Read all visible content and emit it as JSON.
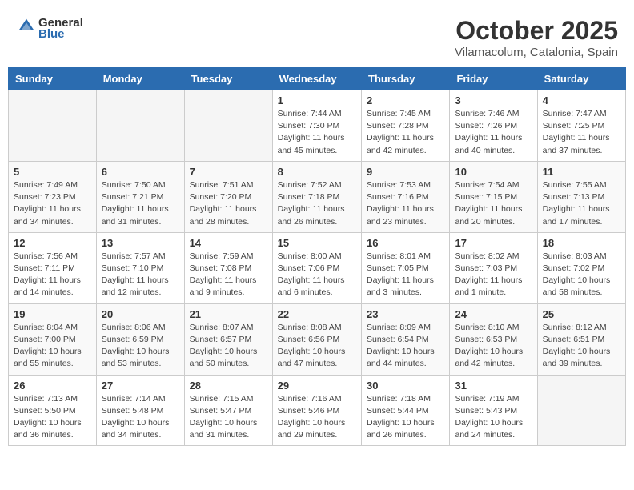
{
  "header": {
    "logo_line1": "General",
    "logo_line2": "Blue",
    "month": "October 2025",
    "location": "Vilamacolum, Catalonia, Spain"
  },
  "weekdays": [
    "Sunday",
    "Monday",
    "Tuesday",
    "Wednesday",
    "Thursday",
    "Friday",
    "Saturday"
  ],
  "weeks": [
    [
      {
        "day": "",
        "info": ""
      },
      {
        "day": "",
        "info": ""
      },
      {
        "day": "",
        "info": ""
      },
      {
        "day": "1",
        "info": "Sunrise: 7:44 AM\nSunset: 7:30 PM\nDaylight: 11 hours\nand 45 minutes."
      },
      {
        "day": "2",
        "info": "Sunrise: 7:45 AM\nSunset: 7:28 PM\nDaylight: 11 hours\nand 42 minutes."
      },
      {
        "day": "3",
        "info": "Sunrise: 7:46 AM\nSunset: 7:26 PM\nDaylight: 11 hours\nand 40 minutes."
      },
      {
        "day": "4",
        "info": "Sunrise: 7:47 AM\nSunset: 7:25 PM\nDaylight: 11 hours\nand 37 minutes."
      }
    ],
    [
      {
        "day": "5",
        "info": "Sunrise: 7:49 AM\nSunset: 7:23 PM\nDaylight: 11 hours\nand 34 minutes."
      },
      {
        "day": "6",
        "info": "Sunrise: 7:50 AM\nSunset: 7:21 PM\nDaylight: 11 hours\nand 31 minutes."
      },
      {
        "day": "7",
        "info": "Sunrise: 7:51 AM\nSunset: 7:20 PM\nDaylight: 11 hours\nand 28 minutes."
      },
      {
        "day": "8",
        "info": "Sunrise: 7:52 AM\nSunset: 7:18 PM\nDaylight: 11 hours\nand 26 minutes."
      },
      {
        "day": "9",
        "info": "Sunrise: 7:53 AM\nSunset: 7:16 PM\nDaylight: 11 hours\nand 23 minutes."
      },
      {
        "day": "10",
        "info": "Sunrise: 7:54 AM\nSunset: 7:15 PM\nDaylight: 11 hours\nand 20 minutes."
      },
      {
        "day": "11",
        "info": "Sunrise: 7:55 AM\nSunset: 7:13 PM\nDaylight: 11 hours\nand 17 minutes."
      }
    ],
    [
      {
        "day": "12",
        "info": "Sunrise: 7:56 AM\nSunset: 7:11 PM\nDaylight: 11 hours\nand 14 minutes."
      },
      {
        "day": "13",
        "info": "Sunrise: 7:57 AM\nSunset: 7:10 PM\nDaylight: 11 hours\nand 12 minutes."
      },
      {
        "day": "14",
        "info": "Sunrise: 7:59 AM\nSunset: 7:08 PM\nDaylight: 11 hours\nand 9 minutes."
      },
      {
        "day": "15",
        "info": "Sunrise: 8:00 AM\nSunset: 7:06 PM\nDaylight: 11 hours\nand 6 minutes."
      },
      {
        "day": "16",
        "info": "Sunrise: 8:01 AM\nSunset: 7:05 PM\nDaylight: 11 hours\nand 3 minutes."
      },
      {
        "day": "17",
        "info": "Sunrise: 8:02 AM\nSunset: 7:03 PM\nDaylight: 11 hours\nand 1 minute."
      },
      {
        "day": "18",
        "info": "Sunrise: 8:03 AM\nSunset: 7:02 PM\nDaylight: 10 hours\nand 58 minutes."
      }
    ],
    [
      {
        "day": "19",
        "info": "Sunrise: 8:04 AM\nSunset: 7:00 PM\nDaylight: 10 hours\nand 55 minutes."
      },
      {
        "day": "20",
        "info": "Sunrise: 8:06 AM\nSunset: 6:59 PM\nDaylight: 10 hours\nand 53 minutes."
      },
      {
        "day": "21",
        "info": "Sunrise: 8:07 AM\nSunset: 6:57 PM\nDaylight: 10 hours\nand 50 minutes."
      },
      {
        "day": "22",
        "info": "Sunrise: 8:08 AM\nSunset: 6:56 PM\nDaylight: 10 hours\nand 47 minutes."
      },
      {
        "day": "23",
        "info": "Sunrise: 8:09 AM\nSunset: 6:54 PM\nDaylight: 10 hours\nand 44 minutes."
      },
      {
        "day": "24",
        "info": "Sunrise: 8:10 AM\nSunset: 6:53 PM\nDaylight: 10 hours\nand 42 minutes."
      },
      {
        "day": "25",
        "info": "Sunrise: 8:12 AM\nSunset: 6:51 PM\nDaylight: 10 hours\nand 39 minutes."
      }
    ],
    [
      {
        "day": "26",
        "info": "Sunrise: 7:13 AM\nSunset: 5:50 PM\nDaylight: 10 hours\nand 36 minutes."
      },
      {
        "day": "27",
        "info": "Sunrise: 7:14 AM\nSunset: 5:48 PM\nDaylight: 10 hours\nand 34 minutes."
      },
      {
        "day": "28",
        "info": "Sunrise: 7:15 AM\nSunset: 5:47 PM\nDaylight: 10 hours\nand 31 minutes."
      },
      {
        "day": "29",
        "info": "Sunrise: 7:16 AM\nSunset: 5:46 PM\nDaylight: 10 hours\nand 29 minutes."
      },
      {
        "day": "30",
        "info": "Sunrise: 7:18 AM\nSunset: 5:44 PM\nDaylight: 10 hours\nand 26 minutes."
      },
      {
        "day": "31",
        "info": "Sunrise: 7:19 AM\nSunset: 5:43 PM\nDaylight: 10 hours\nand 24 minutes."
      },
      {
        "day": "",
        "info": ""
      }
    ]
  ]
}
